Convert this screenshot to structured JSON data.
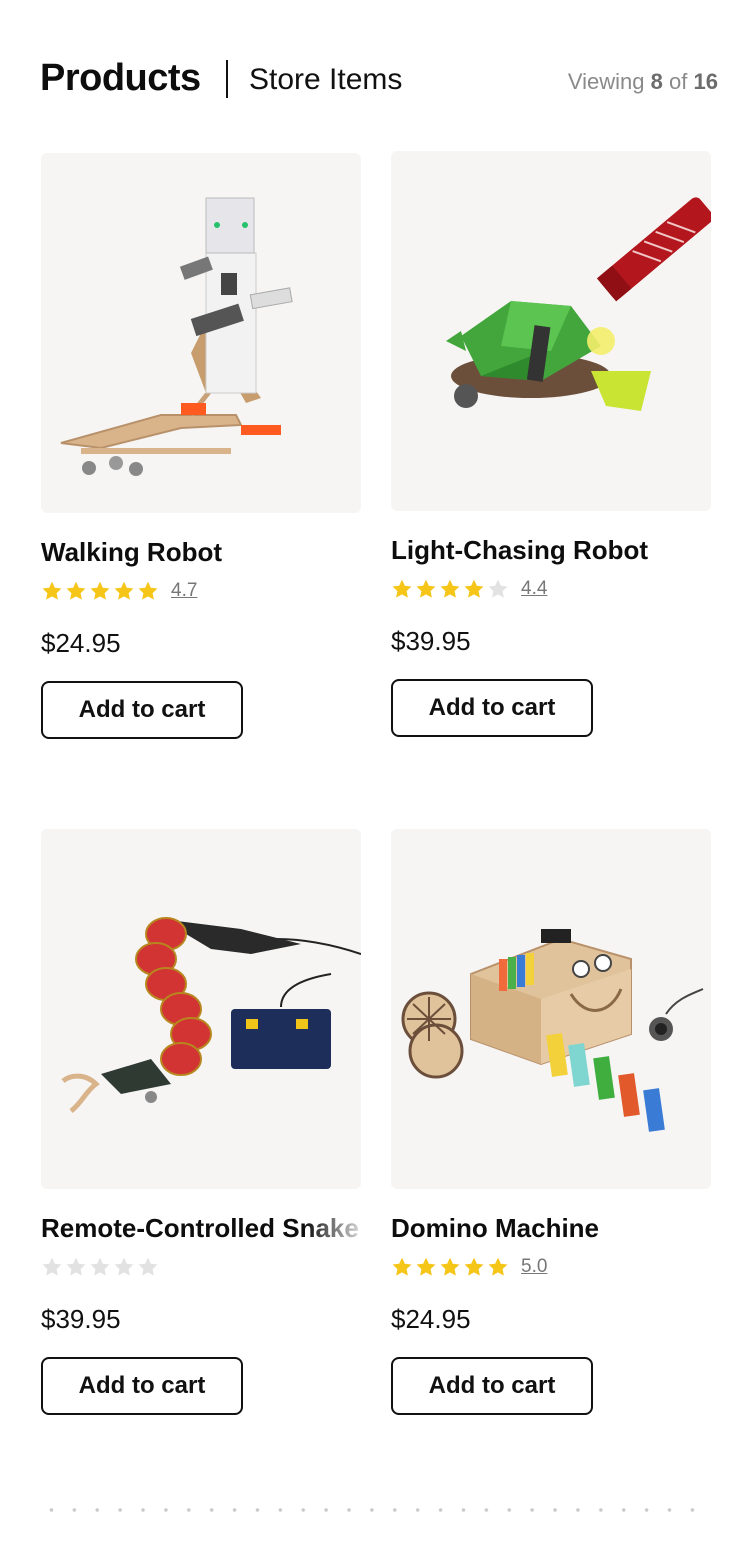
{
  "header": {
    "title": "Products",
    "subtitle": "Store Items",
    "viewing_prefix": "Viewing",
    "viewing_count": "8",
    "viewing_of": "of",
    "viewing_total": "16"
  },
  "colors": {
    "star_filled": "#f5c518",
    "star_empty": "#e2e2e2",
    "image_bg": "#f6f5f4"
  },
  "products": [
    {
      "name": "Walking Robot",
      "rating": 4.7,
      "rating_label": "4.7",
      "price": "$24.95",
      "cta": "Add to cart",
      "image": "walking-robot-image"
    },
    {
      "name": "Light-Chasing Robot",
      "rating": 4.4,
      "rating_label": "4.4",
      "price": "$39.95",
      "cta": "Add to cart",
      "image": "light-chasing-robot-image"
    },
    {
      "name": "Remote-Controlled Snake",
      "rating": 0,
      "rating_label": "",
      "price": "$39.95",
      "cta": "Add to cart",
      "image": "remote-controlled-snake-image"
    },
    {
      "name": "Domino Machine",
      "rating": 5.0,
      "rating_label": "5.0",
      "price": "$24.95",
      "cta": "Add to cart",
      "image": "domino-machine-image"
    }
  ]
}
